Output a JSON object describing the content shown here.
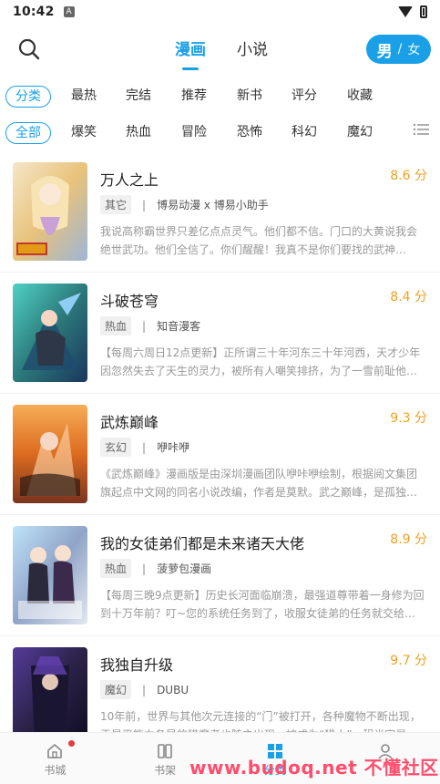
{
  "status": {
    "time": "10:42",
    "notification_icon": "A"
  },
  "header": {
    "tabs": [
      {
        "label": "漫画",
        "active": true
      },
      {
        "label": "小说",
        "active": false
      }
    ],
    "gender": {
      "male": "男",
      "sep": "/",
      "female": "女"
    }
  },
  "sort_row": [
    "分类",
    "最热",
    "完结",
    "推荐",
    "新书",
    "评分",
    "收藏"
  ],
  "genre_row": [
    "全部",
    "爆笑",
    "热血",
    "冒险",
    "恐怖",
    "科幻",
    "魔幻"
  ],
  "books": [
    {
      "title": "万人之上",
      "score": "8.6 分",
      "tag": "其它",
      "author": "博易动漫 x 博易小助手",
      "desc": "我说高称霸世界只差亿点点灵气。他们都不信。门口的大黄说我会绝世武功。他们全信了。你们醒醒！我真不是你们要找的武神…"
    },
    {
      "title": "斗破苍穹",
      "score": "8.4 分",
      "tag": "热血",
      "author": "知音漫客",
      "desc": "【每周六周日12点更新】正所谓三十年河东三十年河西，天才少年因忽然失去了天生的灵力，被所有人嘲笑排挤，为了一雪前耻他…"
    },
    {
      "title": "武炼巅峰",
      "score": "9.3 分",
      "tag": "玄幻",
      "author": "咿咔咿",
      "desc": "《武炼巅峰》漫画版是由深圳漫画团队咿咔咿绘制，根据阅文集团旗起点中文网的同名小说改编，作者是莫默。武之巅峰，是孤独…"
    },
    {
      "title": "我的女徒弟们都是未来诸天大佬",
      "score": "8.9 分",
      "tag": "热血",
      "author": "菠萝包漫画",
      "desc": "【每周三晚9点更新】历史长河面临崩溃，最强道尊带着一身修为回到十万年前？叮~您的系统任务到了，收服女徒弟的任务就交给…"
    },
    {
      "title": "我独自升级",
      "score": "9.7 分",
      "tag": "魔幻",
      "author": "DUBU",
      "desc": "10年前，世界与其他次元连接的“门”被打开，各种魔物不断出现，于是平能力各异的猎魔者也随之出现，被成为“猎人”。程肖宇是一…"
    }
  ],
  "bottom_nav": [
    {
      "label": "书城",
      "icon": "home-icon"
    },
    {
      "label": "书架",
      "icon": "book-icon"
    },
    {
      "label": "分类",
      "icon": "grid-icon",
      "active": true
    }
  ],
  "watermark": {
    "site": "www.budoq.net",
    "name": "不懂社区"
  },
  "colors": {
    "accent": "#1aa0e6",
    "score": "#f0a020",
    "red_dot": "#e8373f"
  }
}
